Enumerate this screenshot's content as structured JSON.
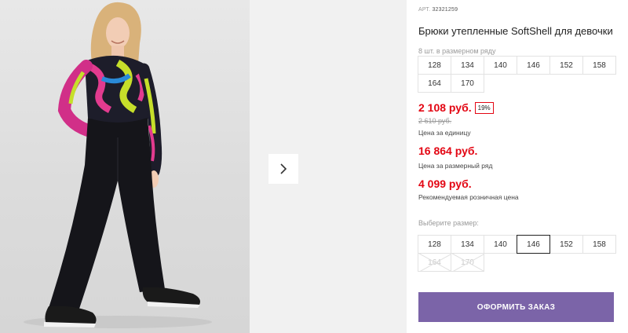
{
  "product": {
    "article_label": "АРТ.",
    "article_number": "32321259",
    "title": "Брюки утепленные SoftShell для девочки",
    "range_note": "8 шт. в размерном ряду",
    "range_sizes": [
      "128",
      "134",
      "140",
      "146",
      "152",
      "158",
      "164",
      "170"
    ],
    "unit_price": "2 108 руб.",
    "discount": "19%",
    "old_price": "2 610 руб.",
    "unit_price_label": "Цена за единицу",
    "range_price": "16 864 руб.",
    "range_price_label": "Цена за размерный ряд",
    "retail_price": "4 099 руб.",
    "retail_price_label": "Рекомендуемая розничная цена",
    "choose_size_label": "Выберите размер:",
    "selectable_sizes": [
      {
        "label": "128",
        "state": "available"
      },
      {
        "label": "134",
        "state": "available"
      },
      {
        "label": "140",
        "state": "available"
      },
      {
        "label": "146",
        "state": "selected"
      },
      {
        "label": "152",
        "state": "available"
      },
      {
        "label": "158",
        "state": "available"
      },
      {
        "label": "164",
        "state": "unavailable"
      },
      {
        "label": "170",
        "state": "unavailable"
      }
    ],
    "order_button": "ОФОРМИТЬ ЗАКАЗ"
  },
  "gallery": {
    "next_icon": "chevron-right-icon"
  },
  "colors": {
    "price_red": "#e30613",
    "button_purple": "#7b64a8"
  }
}
